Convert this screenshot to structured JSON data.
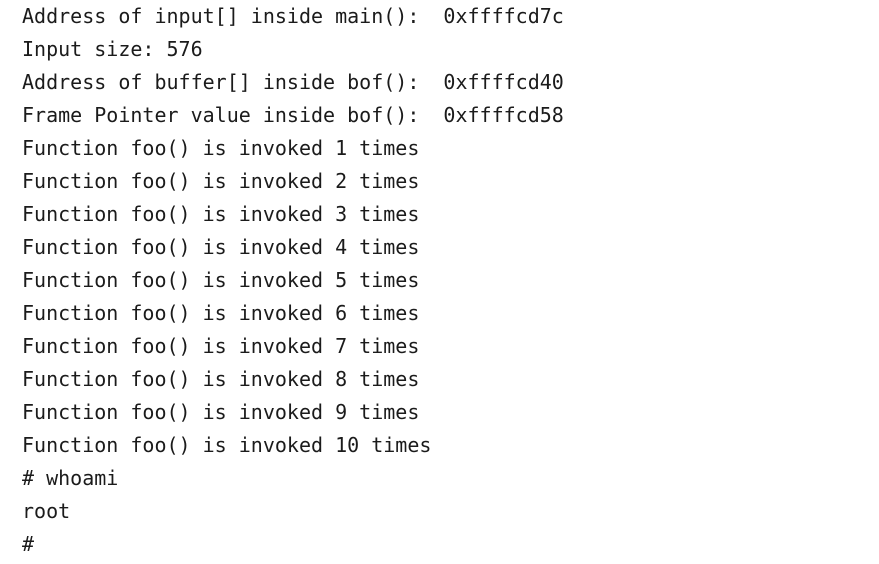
{
  "terminal": {
    "background_color": "#ffffff",
    "text_color": "#1b1b1b",
    "prompt_symbol": "#",
    "lines": [
      {
        "text": "Address of input[] inside main():  0xffffcd7c"
      },
      {
        "text": "Input size: 576"
      },
      {
        "text": "Address of buffer[] inside bof():  0xffffcd40"
      },
      {
        "text": "Frame Pointer value inside bof():  0xffffcd58"
      },
      {
        "text": "Function foo() is invoked 1 times"
      },
      {
        "text": "Function foo() is invoked 2 times"
      },
      {
        "text": "Function foo() is invoked 3 times"
      },
      {
        "text": "Function foo() is invoked 4 times"
      },
      {
        "text": "Function foo() is invoked 5 times"
      },
      {
        "text": "Function foo() is invoked 6 times"
      },
      {
        "text": "Function foo() is invoked 7 times"
      },
      {
        "text": "Function foo() is invoked 8 times"
      },
      {
        "text": "Function foo() is invoked 9 times"
      },
      {
        "text": "Function foo() is invoked 10 times"
      },
      {
        "text": "# whoami"
      },
      {
        "text": "root"
      },
      {
        "text": "#"
      }
    ]
  }
}
